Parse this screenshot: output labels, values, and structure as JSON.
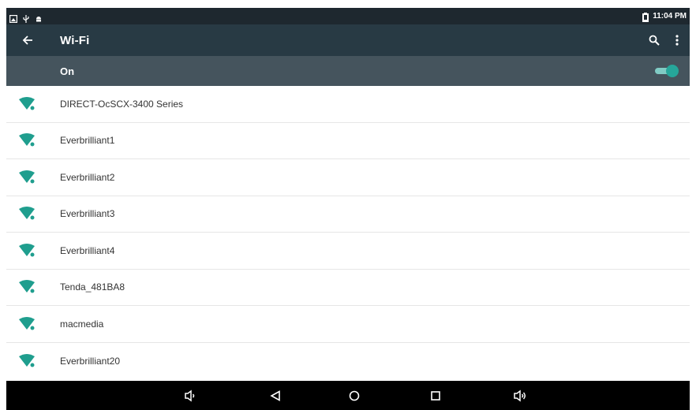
{
  "status_bar": {
    "time": "11:04 PM",
    "icons": [
      "screenshot-icon",
      "usb-icon",
      "android-debug-icon",
      "battery-icon"
    ]
  },
  "toolbar": {
    "title": "Wi-Fi",
    "back_icon": "arrow-back-icon",
    "actions": [
      "search-icon",
      "more-vert-icon"
    ]
  },
  "wifi_switch": {
    "label": "On",
    "enabled": true
  },
  "networks": [
    {
      "ssid": "DIRECT-OcSCX-3400 Series",
      "locked": false
    },
    {
      "ssid": "Everbrilliant1",
      "locked": false
    },
    {
      "ssid": "Everbrilliant2",
      "locked": false
    },
    {
      "ssid": "Everbrilliant3",
      "locked": false
    },
    {
      "ssid": "Everbrilliant4",
      "locked": false
    },
    {
      "ssid": "Tenda_481BA8",
      "locked": false
    },
    {
      "ssid": "macmedia",
      "locked": false
    },
    {
      "ssid": "Everbrilliant20",
      "locked": false
    }
  ],
  "nav_bar": [
    "volume-down-icon",
    "back-triangle-icon",
    "home-circle-icon",
    "recents-square-icon",
    "volume-up-icon"
  ],
  "colors": {
    "status_bar": "#1e282f",
    "toolbar": "#283a44",
    "switch_bar": "#45545d",
    "accent": "#26a69a",
    "wifi_icon": "#1f9e8e"
  }
}
